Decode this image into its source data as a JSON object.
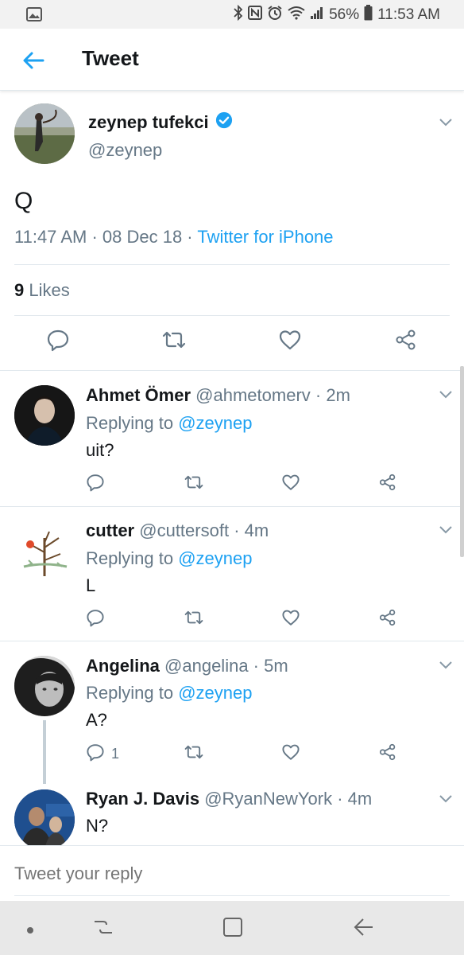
{
  "status_bar": {
    "battery": "56%",
    "time": "11:53 AM"
  },
  "header": {
    "title": "Tweet"
  },
  "main_tweet": {
    "name": "zeynep tufekci",
    "handle": "@zeynep",
    "text": "Q",
    "time": "11:47 AM",
    "sep1": " · ",
    "date": "08 Dec 18",
    "sep2": " · ",
    "source": "Twitter for iPhone",
    "likes_count": "9",
    "likes_label": " Likes"
  },
  "replies": [
    {
      "name": "Ahmet Ömer",
      "handle": "@ahmetomerv",
      "ago": " · 2m",
      "replying_prefix": "Replying to ",
      "replying_to": "@zeynep",
      "text": "uit?",
      "reply_count": ""
    },
    {
      "name": "cutter",
      "handle": "@cuttersoft",
      "ago": " · 4m",
      "replying_prefix": "Replying to ",
      "replying_to": "@zeynep",
      "text": "L",
      "reply_count": ""
    },
    {
      "name": "Angelina",
      "handle": "@angelina",
      "ago": " · 5m",
      "replying_prefix": "Replying to ",
      "replying_to": "@zeynep",
      "text": "A?",
      "reply_count": "1"
    },
    {
      "name": "Ryan J. Davis",
      "handle": "@RyanNewYork",
      "ago": " · 4m",
      "text": "N?"
    }
  ],
  "reply_box": {
    "placeholder": "Tweet your reply"
  },
  "colors": {
    "accent": "#1da1f2",
    "text": "#14171a",
    "muted": "#657786",
    "divider": "#e1e8ed"
  }
}
